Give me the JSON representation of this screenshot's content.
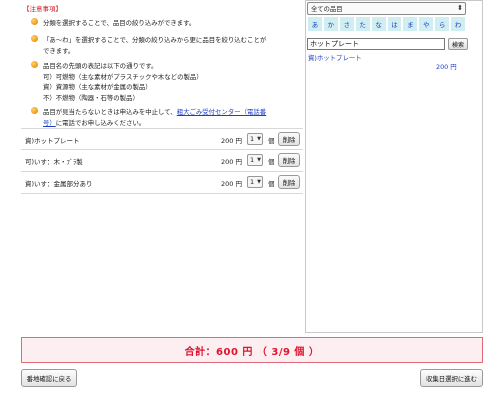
{
  "notice": {
    "title": "【注意事項】",
    "items": [
      {
        "lines": [
          "分類を選択することで、品目の絞り込みができます。"
        ]
      },
      {
        "lines": [
          "「あ〜わ」を選択することで、分類の絞り込みから更に品目を絞り込むことが",
          "できます。"
        ]
      },
      {
        "lines": [
          "品目名の先頭の表記は以下の通りです。",
          "可）可燃物（主な素材がプラスチックや木などの製品）",
          "資）資源物（主な素材が金属の製品）",
          "不）不燃物（陶器・石等の製品）"
        ]
      }
    ],
    "last": {
      "pre": "品目が見当たらないときは申込みを中止して、",
      "link": "粗大ごみ受付センター（電話番",
      "link2": "号）",
      "post": "に電話でお申し込みください。"
    }
  },
  "items": [
    {
      "name": "資)ホットプレート",
      "price": "200 円",
      "qty": "1",
      "unit": "個",
      "delete": "削除"
    },
    {
      "name": "可)いす：木・ﾌﾞﾗ製",
      "price": "200 円",
      "qty": "1",
      "unit": "個",
      "delete": "削除"
    },
    {
      "name": "資)いす：金属部分あり",
      "price": "200 円",
      "qty": "1",
      "unit": "個",
      "delete": "削除"
    }
  ],
  "side": {
    "category": "全ての品目",
    "kana": [
      "あ",
      "か",
      "さ",
      "た",
      "な",
      "は",
      "ま",
      "や",
      "ら",
      "わ"
    ],
    "search_value": "ホットプレート",
    "search_button": "検索",
    "result_name": "資)ホットプレート",
    "result_price": "200 円"
  },
  "total": "合計：600 円 （ 3/9 個 ）",
  "buttons": {
    "back": "番地確認に戻る",
    "next": "収集日選択に進む"
  },
  "colors": {
    "accent_red": "#e0122d",
    "link_blue": "#1f3fbf",
    "kana_bg": "#cfeef2",
    "total_bg": "#fdeef1"
  }
}
